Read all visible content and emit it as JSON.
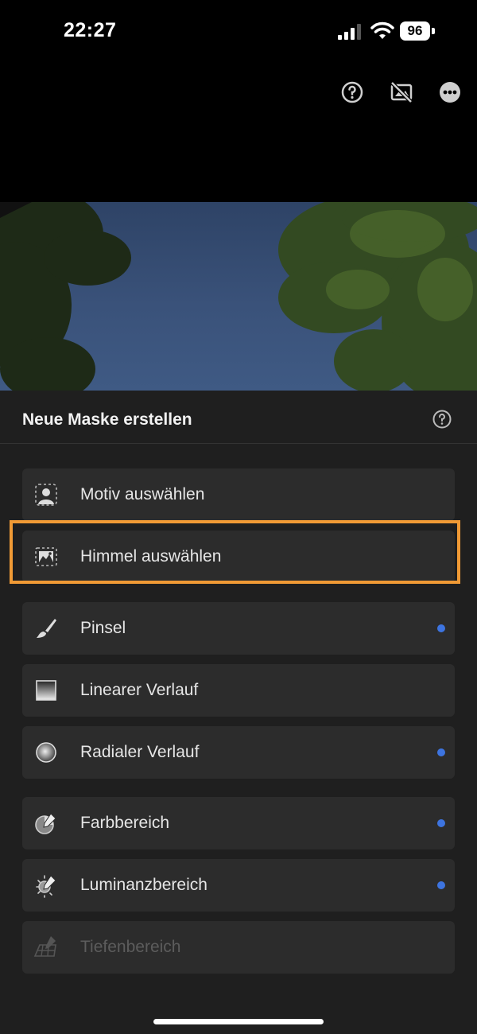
{
  "status": {
    "time": "22:27",
    "battery": "96"
  },
  "toolbar": {
    "icons": [
      "help-icon",
      "compare-off-icon",
      "more-icon"
    ]
  },
  "sheet": {
    "title": "Neue Maske erstellen",
    "items": [
      {
        "label": "Motiv auswählen",
        "icon": "select-subject-icon",
        "dot": false,
        "enabled": true,
        "highlighted": false
      },
      {
        "label": "Himmel auswählen",
        "icon": "select-sky-icon",
        "dot": false,
        "enabled": true,
        "highlighted": true
      },
      {
        "label": "Pinsel",
        "icon": "brush-icon",
        "dot": true,
        "enabled": true,
        "highlighted": false
      },
      {
        "label": "Linearer Verlauf",
        "icon": "linear-gradient-icon",
        "dot": false,
        "enabled": true,
        "highlighted": false
      },
      {
        "label": "Radialer Verlauf",
        "icon": "radial-gradient-icon",
        "dot": true,
        "enabled": true,
        "highlighted": false
      },
      {
        "label": "Farbbereich",
        "icon": "color-range-icon",
        "dot": true,
        "enabled": true,
        "highlighted": false
      },
      {
        "label": "Luminanzbereich",
        "icon": "luminance-range-icon",
        "dot": true,
        "enabled": true,
        "highlighted": false
      },
      {
        "label": "Tiefenbereich",
        "icon": "depth-range-icon",
        "dot": false,
        "enabled": false,
        "highlighted": false
      }
    ]
  },
  "colors": {
    "accent_dot": "#3d74e0",
    "highlight": "#f09a35",
    "sheet_bg": "#1f1f1f",
    "item_bg": "#2c2c2c"
  }
}
